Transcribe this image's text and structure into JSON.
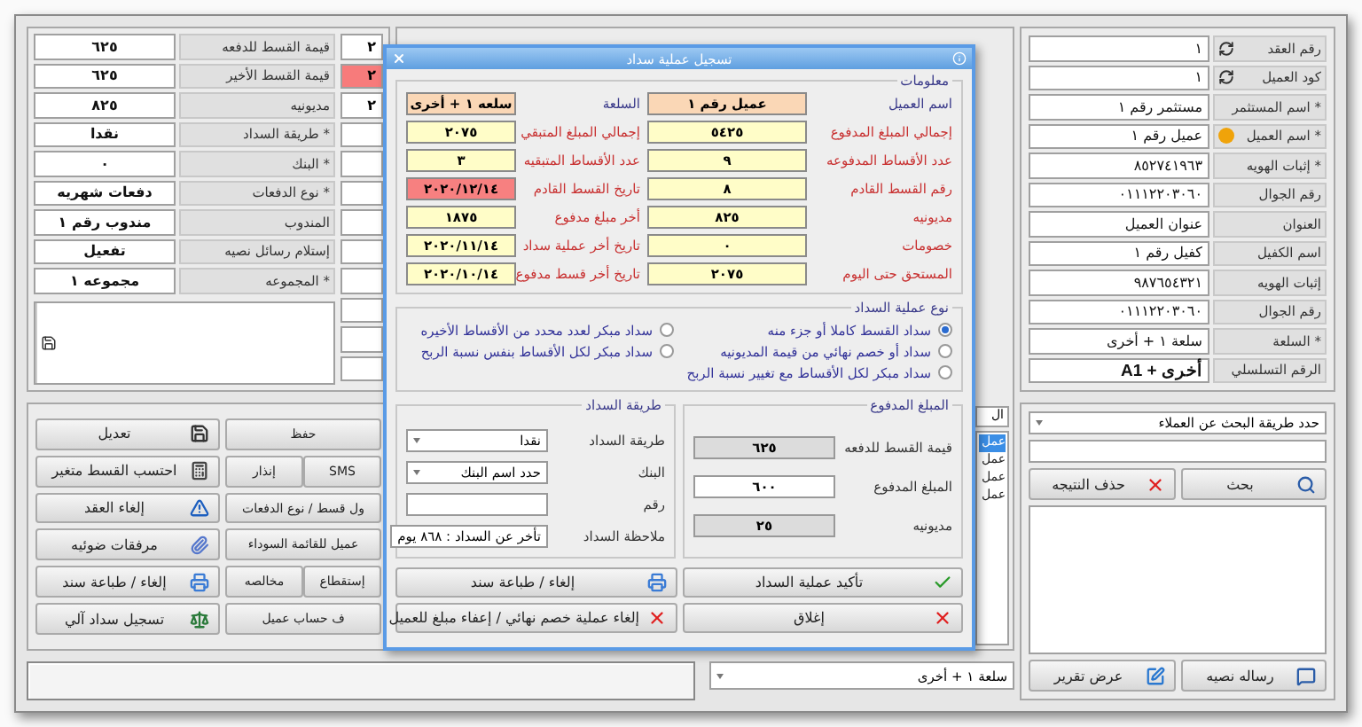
{
  "contract": {
    "fields": [
      {
        "kind": "lookup",
        "label": "رقم العقد",
        "value": "١"
      },
      {
        "kind": "lookup",
        "label": "كود العميل",
        "value": "١"
      },
      {
        "kind": "plain",
        "label": "* اسم المستثمر",
        "value": "مستثمر رقم ١"
      },
      {
        "kind": "warning",
        "label": "* اسم العميل",
        "value": "عميل رقم ١"
      },
      {
        "kind": "plain",
        "label": "* إثبات الهويه",
        "value": "٨٥٢٧٤١٩٦٣"
      },
      {
        "kind": "plain",
        "label": "رقم الجوال",
        "value": "٠١١١٢٢٠٣٠٦٠"
      },
      {
        "kind": "plain",
        "label": "العنوان",
        "value": "عنوان العميل"
      },
      {
        "kind": "plain",
        "label": "اسم الكفيل",
        "value": "كفيل رقم ١"
      },
      {
        "kind": "plain",
        "label": "إثبات الهويه",
        "value": "٩٨٧٦٥٤٣٢١"
      },
      {
        "kind": "plain",
        "label": "رقم الجوال",
        "value": "٠١١١٢٢٠٣٠٦٠"
      },
      {
        "kind": "plain",
        "label": "* السلعة",
        "value": "سلعة ١ + أخرى"
      },
      {
        "kind": "bold",
        "label": "الرقم التسلسلي",
        "value": "A1 + أخرى"
      }
    ]
  },
  "installments": {
    "fields": [
      {
        "label": "قيمة القسط للدفعه",
        "value": "٦٢٥"
      },
      {
        "label": "قيمة القسط الأخير",
        "value": "٦٢٥"
      },
      {
        "label": "مديونيه",
        "value": "٨٢٥"
      },
      {
        "label": "* طريقة السداد",
        "value": "نقدا"
      },
      {
        "label": "* البنك",
        "value": "٠"
      },
      {
        "label": "* نوع الدفعات",
        "value": "دفعات شهريه"
      },
      {
        "label": "المندوب",
        "value": "مندوب رقم ١"
      },
      {
        "label": "إستلام رسائل نصيه",
        "value": "تفعيل"
      },
      {
        "label": "* المجموعه",
        "value": "مجموعه ١"
      }
    ],
    "side": [
      {
        "value": "٢",
        "alert": false
      },
      {
        "value": "٢",
        "alert": true
      },
      {
        "value": "٢",
        "alert": false
      },
      {
        "alert": false
      },
      {
        "alert": false
      },
      {
        "alert": false
      },
      {
        "alert": false
      },
      {
        "alert": false
      },
      {
        "alert": false
      },
      {
        "alert": false
      },
      {
        "alert": false
      },
      {
        "alert": false
      }
    ]
  },
  "actions": [
    {
      "main": {
        "label": "تعديل"
      },
      "side": [
        {
          "label": "حفظ"
        }
      ]
    },
    {
      "main": {
        "label": "احتسب القسط متغير"
      },
      "side": [
        {
          "label": "SMS"
        },
        {
          "label": "إنذار"
        }
      ]
    },
    {
      "main": {
        "label": "إلغاء العقد"
      },
      "side": [
        {
          "label": "ول قسط / نوع الدفعات"
        }
      ]
    },
    {
      "main": {
        "label": "مرفقات ضوئيه"
      },
      "side": [
        {
          "label": "عميل للقائمة السوداء"
        }
      ]
    },
    {
      "main": {
        "label": "إلغاء / طباعة سند"
      },
      "side": [
        {
          "label": "إستقطاع"
        },
        {
          "label": "مخالصه"
        }
      ]
    },
    {
      "main": {
        "label": "تسجيل سداد آلي"
      },
      "side": [
        {
          "label": "ف حساب عميل"
        }
      ]
    }
  ],
  "results_list": {
    "header": "ال",
    "items": [
      {
        "label": "عمل",
        "selected": true
      },
      {
        "label": "عمل",
        "selected": false
      },
      {
        "label": "عمل",
        "selected": false
      },
      {
        "label": "عمل",
        "selected": false
      }
    ]
  },
  "product_select": {
    "value": "سلعة ١ + أخرى"
  },
  "search": {
    "method": "حدد طريقة البحث عن العملاء",
    "buttons": [
      {
        "label": "بحث"
      },
      {
        "label": "حذف النتيجه"
      }
    ],
    "bottom_buttons": [
      {
        "label": "رساله نصيه"
      },
      {
        "label": "عرض تقرير"
      }
    ]
  },
  "dialog": {
    "title": "تسجيل عملية سداد",
    "info": {
      "legend": "معلومات",
      "rows": [
        [
          {
            "label": "اسم العميل",
            "value": "عميل رقم ١",
            "kind": "highlight"
          },
          {
            "label": "السلعة",
            "value": "سلعه ١ + أخرى",
            "kind": "highlight"
          }
        ],
        [
          {
            "label": "إجمالي المبلغ المدفوع",
            "value": "٥٤٢٥",
            "kind": "normal"
          },
          {
            "label": "إجمالي المبلغ المتبقي",
            "value": "٢٠٧٥",
            "kind": "normal"
          }
        ],
        [
          {
            "label": "عدد الأقساط المدفوعه",
            "value": "٩",
            "kind": "normal"
          },
          {
            "label": "عدد الأقساط المتبقيه",
            "value": "٣",
            "kind": "normal"
          }
        ],
        [
          {
            "label": "رقم القسط القادم",
            "value": "٨",
            "kind": "normal"
          },
          {
            "label": "تاريخ القسط القادم",
            "value": "٢٠٢٠/١٢/١٤",
            "kind": "alert"
          }
        ],
        [
          {
            "label": "مديونيه",
            "value": "٨٢٥",
            "kind": "normal"
          },
          {
            "label": "أخر مبلغ مدفوع",
            "value": "١٨٧٥",
            "kind": "normal"
          }
        ],
        [
          {
            "label": "خصومات",
            "value": "٠",
            "kind": "normal"
          },
          {
            "label": "تاريخ أخر عملية سداد",
            "value": "٢٠٢٠/١١/١٤",
            "kind": "normal"
          }
        ],
        [
          {
            "label": "المستحق حتى اليوم",
            "value": "٢٠٧٥",
            "kind": "normal"
          },
          {
            "label": "تاريخ أخر قسط مدفوع",
            "value": "٢٠٢٠/١٠/١٤",
            "kind": "normal"
          }
        ]
      ]
    },
    "payment_type": {
      "legend": "نوع عملية السداد",
      "options": [
        {
          "label": "سداد القسط كاملا أو جزء منه",
          "selected": true
        },
        {
          "label": "سداد أو خصم نهائي من قيمة المديونيه",
          "selected": false
        },
        {
          "label": "سداد مبكر لكل الأقساط مع تغيير نسبة الربح",
          "selected": false
        },
        {
          "label": "سداد مبكر لعدد محدد من الأقساط الأخيره",
          "selected": false
        },
        {
          "label": "سداد مبكر لكل الأقساط بنفس نسبة الربح",
          "selected": false
        }
      ]
    },
    "amount": {
      "legend": "المبلغ المدفوع",
      "fields": [
        {
          "kind": "readonly",
          "label": "قيمة القسط للدفعه",
          "value": "٦٢٥"
        },
        {
          "kind": "input",
          "label": "المبلغ المدفوع",
          "value": "٦٠٠"
        },
        {
          "kind": "readonly",
          "label": "مديونيه",
          "value": "٢٥"
        }
      ]
    },
    "method": {
      "legend": "طريقة السداد",
      "fields": [
        {
          "kind": "select",
          "label": "طريقة السداد",
          "value": "نقدا"
        },
        {
          "kind": "select",
          "label": "البنك",
          "value": "حدد اسم البنك"
        },
        {
          "kind": "input",
          "label": "رقم"
        },
        {
          "kind": "input",
          "label": "ملاحظة السداد",
          "value": "تأخر عن السداد : ٨٦٨ يوم"
        }
      ]
    },
    "buttons": [
      {
        "label": "تأكيد عملية السداد"
      },
      {
        "label": "إلغاء / طباعة سند"
      },
      {
        "label": "إغلاق"
      },
      {
        "label": "إلغاء عملية خصم نهائي / إعفاء مبلغ للعميل"
      }
    ]
  }
}
